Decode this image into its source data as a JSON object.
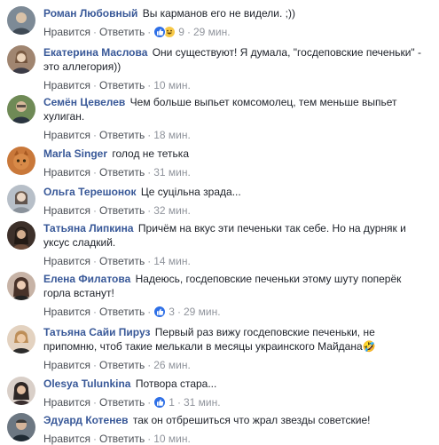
{
  "actions": {
    "like": "Нравится",
    "reply": "Ответить",
    "dot": "·"
  },
  "comments": [
    {
      "author": "Роман Любовный",
      "text": "Вы карманов его не видели. ;))",
      "reactions": {
        "types": [
          "like-icon",
          "haha-icon"
        ],
        "count": "9"
      },
      "time": "29 мин.",
      "avatar_color": "#6b7b8c"
    },
    {
      "author": "Екатерина Маслова",
      "text": "Они существуют! Я думала, \"госдеповские печеньки\" - это аллегория))",
      "time": "10 мин.",
      "avatar_color": "#8a6f5a"
    },
    {
      "author": "Семён Цевелев",
      "text": "Чем больше выпьет комсомолец, тем меньше выпьет хулиган.",
      "time": "18 мин.",
      "avatar_color": "#4f6d3a"
    },
    {
      "author": "Marla Singer",
      "text": "голод не тетька",
      "time": "31 мин.",
      "avatar_color": "#b8612a"
    },
    {
      "author": "Ольга Терешонок",
      "text": "Це суцільна зрада...",
      "time": "32 мин.",
      "avatar_color": "#9aa3ad"
    },
    {
      "author": "Татьяна Липкина",
      "text": "Причём на вкус эти печеньки так себе. Но на дурняк и уксус сладкий.",
      "time": "14 мин.",
      "avatar_color": "#3a2e28"
    },
    {
      "author": "Елена Филатова",
      "text": "Надеюсь, госдеповские печеньки этому шуту поперёк горла встанут!",
      "reactions": {
        "types": [
          "like-icon"
        ],
        "count": "3"
      },
      "time": "29 мин.",
      "avatar_color": "#5b3f34"
    },
    {
      "author": "Татьяна Сайи Пируз",
      "text": "Первый раз вижу госдеповские печеньки, не припомню, чтоб такие мелькали в месяцы украинского Майдана",
      "text_emoji": "🤣",
      "time": "26 мин.",
      "avatar_color": "#c89a6e"
    },
    {
      "author": "Olesya Tulunkina",
      "text": "Потвора стара...",
      "reactions": {
        "types": [
          "like-icon"
        ],
        "count": "1"
      },
      "time": "31 мин.",
      "avatar_color": "#2c2a2e"
    },
    {
      "author": "Эдуард Котенев",
      "text": "так он отбрешиться что жрал звезды советские!",
      "time": "10 мин.",
      "avatar_color": "#55606a"
    }
  ]
}
